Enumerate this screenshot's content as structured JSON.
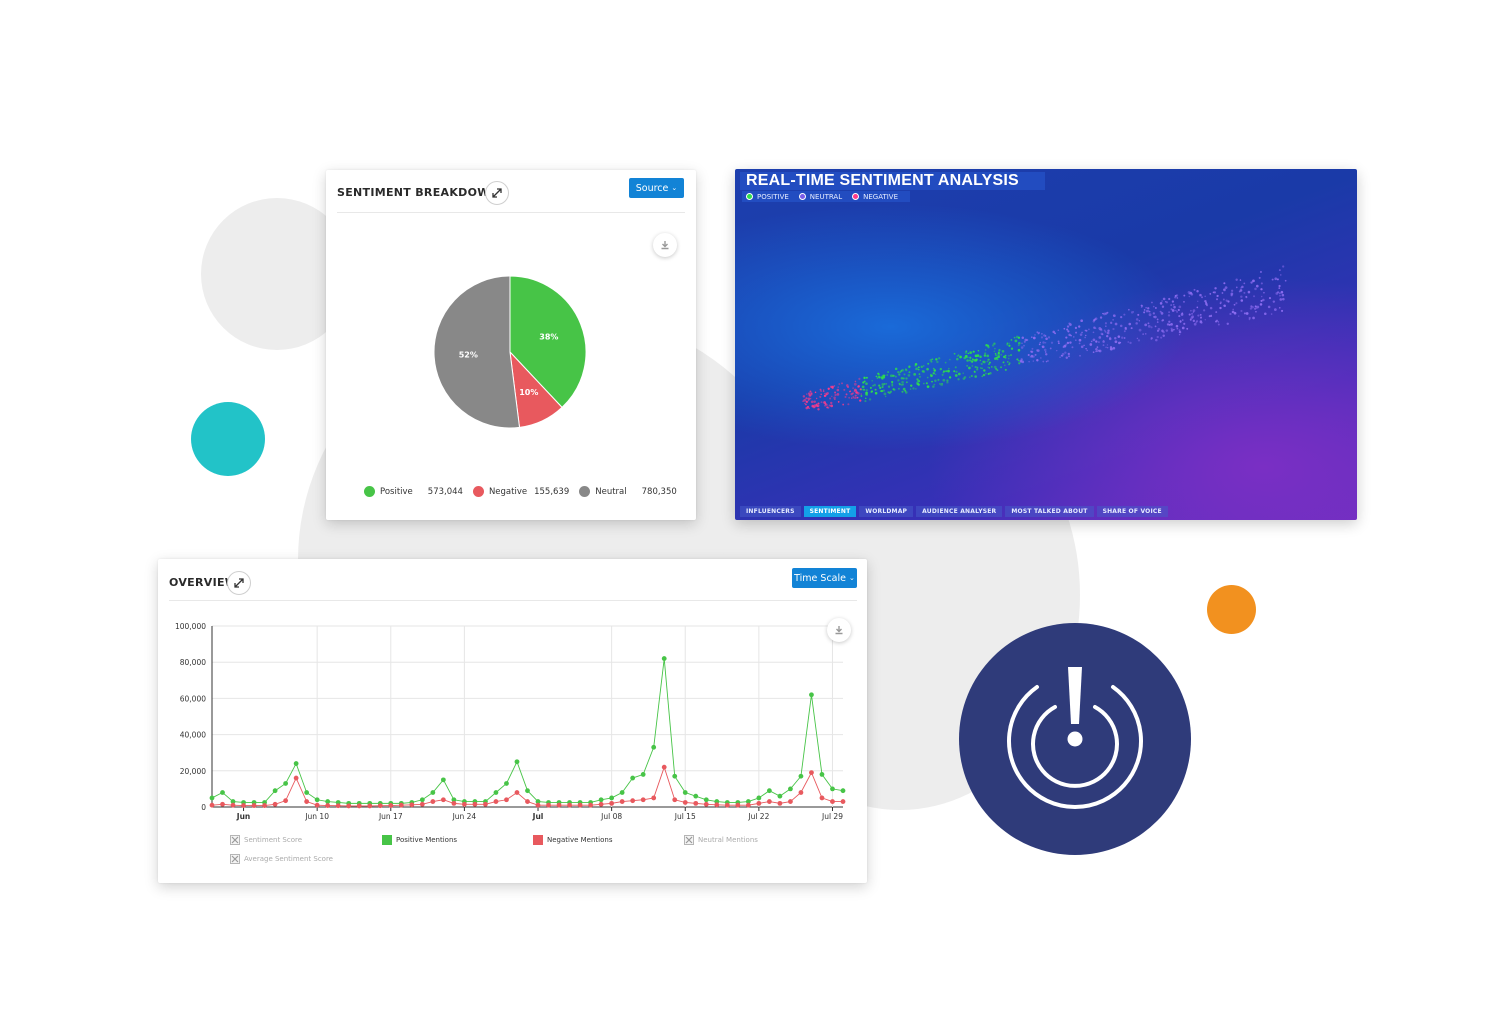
{
  "sentiment_breakdown": {
    "title": "SENTIMENT BREAKDOWN",
    "source_button": "Source",
    "legend": [
      {
        "label": "Positive",
        "value": "573,044",
        "color": "#47c447"
      },
      {
        "label": "Negative",
        "value": "155,639",
        "color": "#e8595e"
      },
      {
        "label": "Neutral",
        "value": "780,350",
        "color": "#888888"
      }
    ]
  },
  "realtime": {
    "title": "REAL-TIME SENTIMENT ANALYSIS",
    "legend": [
      {
        "label": "POSITIVE",
        "color": "#2ee04a"
      },
      {
        "label": "NEUTRAL",
        "color": "#7a5ce8"
      },
      {
        "label": "NEGATIVE",
        "color": "#ff3a8a"
      }
    ],
    "tabs": [
      {
        "label": "INFLUENCERS",
        "active": false
      },
      {
        "label": "SENTIMENT",
        "active": true
      },
      {
        "label": "WORLDMAP",
        "active": false
      },
      {
        "label": "AUDIENCE ANALYSER",
        "active": false
      },
      {
        "label": "MOST TALKED ABOUT",
        "active": false
      },
      {
        "label": "SHARE OF VOICE",
        "active": false
      }
    ]
  },
  "overview": {
    "title": "OVERVIEW",
    "time_scale_button": "Time Scale",
    "legend": [
      {
        "label": "Sentiment Score",
        "enabled": false
      },
      {
        "label": "Positive Mentions",
        "enabled": true,
        "color": "#47c447"
      },
      {
        "label": "Negative Mentions",
        "enabled": true,
        "color": "#e8595e"
      },
      {
        "label": "Neutral Mentions",
        "enabled": false
      },
      {
        "label": "Average Sentiment Score",
        "enabled": false
      }
    ]
  },
  "chart_data": [
    {
      "type": "pie",
      "title": "",
      "categories": [
        "Positive",
        "Negative",
        "Neutral"
      ],
      "values": [
        38,
        10,
        52
      ],
      "labels": [
        "38%",
        "10%",
        "52%"
      ],
      "colors": [
        "#47c447",
        "#e8595e",
        "#888888"
      ]
    },
    {
      "type": "line",
      "title": "",
      "xlabel": "",
      "ylabel": "",
      "ylim": [
        0,
        100000
      ],
      "yticks": [
        "0",
        "20,000",
        "40,000",
        "60,000",
        "80,000",
        "100,000"
      ],
      "xticks": [
        {
          "label": "Jun",
          "index": 3,
          "bold": true
        },
        {
          "label": "Jun 10",
          "index": 10,
          "bold": false
        },
        {
          "label": "Jun 17",
          "index": 17,
          "bold": false
        },
        {
          "label": "Jun 24",
          "index": 24,
          "bold": false
        },
        {
          "label": "Jul",
          "index": 31,
          "bold": true
        },
        {
          "label": "Jul 08",
          "index": 38,
          "bold": false
        },
        {
          "label": "Jul 15",
          "index": 45,
          "bold": false
        },
        {
          "label": "Jul 22",
          "index": 52,
          "bold": false
        },
        {
          "label": "Jul 29",
          "index": 59,
          "bold": false
        }
      ],
      "grid": true,
      "series": [
        {
          "name": "Positive Mentions",
          "color": "#47c447",
          "values": [
            5000,
            8000,
            3000,
            2500,
            2500,
            2500,
            9000,
            13000,
            24000,
            8000,
            4000,
            3000,
            2500,
            2000,
            2000,
            2000,
            2000,
            2000,
            2000,
            2500,
            4000,
            8000,
            15000,
            4000,
            3000,
            3000,
            3000,
            8000,
            13000,
            25000,
            9000,
            3000,
            2500,
            2500,
            2500,
            2500,
            2500,
            4000,
            5000,
            8000,
            16000,
            18000,
            33000,
            82000,
            17000,
            8000,
            6000,
            4000,
            3000,
            2500,
            2500,
            3000,
            5000,
            9000,
            6000,
            10000,
            17000,
            62000,
            18000,
            10000,
            9000
          ]
        },
        {
          "name": "Negative Mentions",
          "color": "#e8595e",
          "values": [
            1000,
            1500,
            1000,
            800,
            800,
            800,
            1500,
            3500,
            16000,
            3000,
            1000,
            800,
            700,
            600,
            600,
            600,
            700,
            800,
            1000,
            1200,
            1500,
            3000,
            4000,
            2000,
            1500,
            1500,
            1500,
            3000,
            4000,
            8000,
            3000,
            1000,
            1000,
            1000,
            1000,
            1000,
            1000,
            1500,
            2000,
            3000,
            3500,
            4000,
            5000,
            22000,
            4000,
            2500,
            2000,
            1500,
            1200,
            1000,
            1000,
            1000,
            2000,
            3000,
            2000,
            3000,
            8000,
            19000,
            5000,
            3000,
            3000
          ]
        }
      ]
    }
  ]
}
